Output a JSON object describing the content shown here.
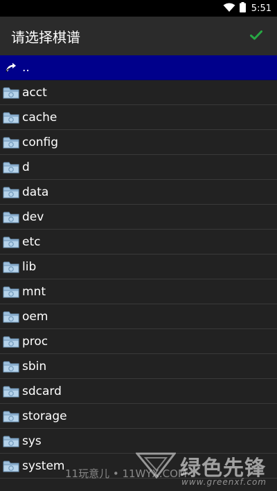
{
  "status_bar": {
    "time": "5:51",
    "icons": [
      "wifi-icon",
      "battery-icon"
    ]
  },
  "app_bar": {
    "title": "请选择棋谱",
    "confirm_icon": "checkmark-icon",
    "confirm_color": "#27a844"
  },
  "list": {
    "parent_entry": {
      "label": "..",
      "icon": "back-arrow-icon",
      "highlight_color": "#00008b"
    },
    "folders": [
      "acct",
      "cache",
      "config",
      "d",
      "data",
      "dev",
      "etc",
      "lib",
      "mnt",
      "oem",
      "proc",
      "sbin",
      "sdcard",
      "storage",
      "sys",
      "system"
    ],
    "folder_icon": "folder-icon"
  },
  "watermark": {
    "caption": "11玩意儿 • 11WYX.COM",
    "logo_text": "绿色先锋",
    "url": "www.greenxf.com"
  }
}
